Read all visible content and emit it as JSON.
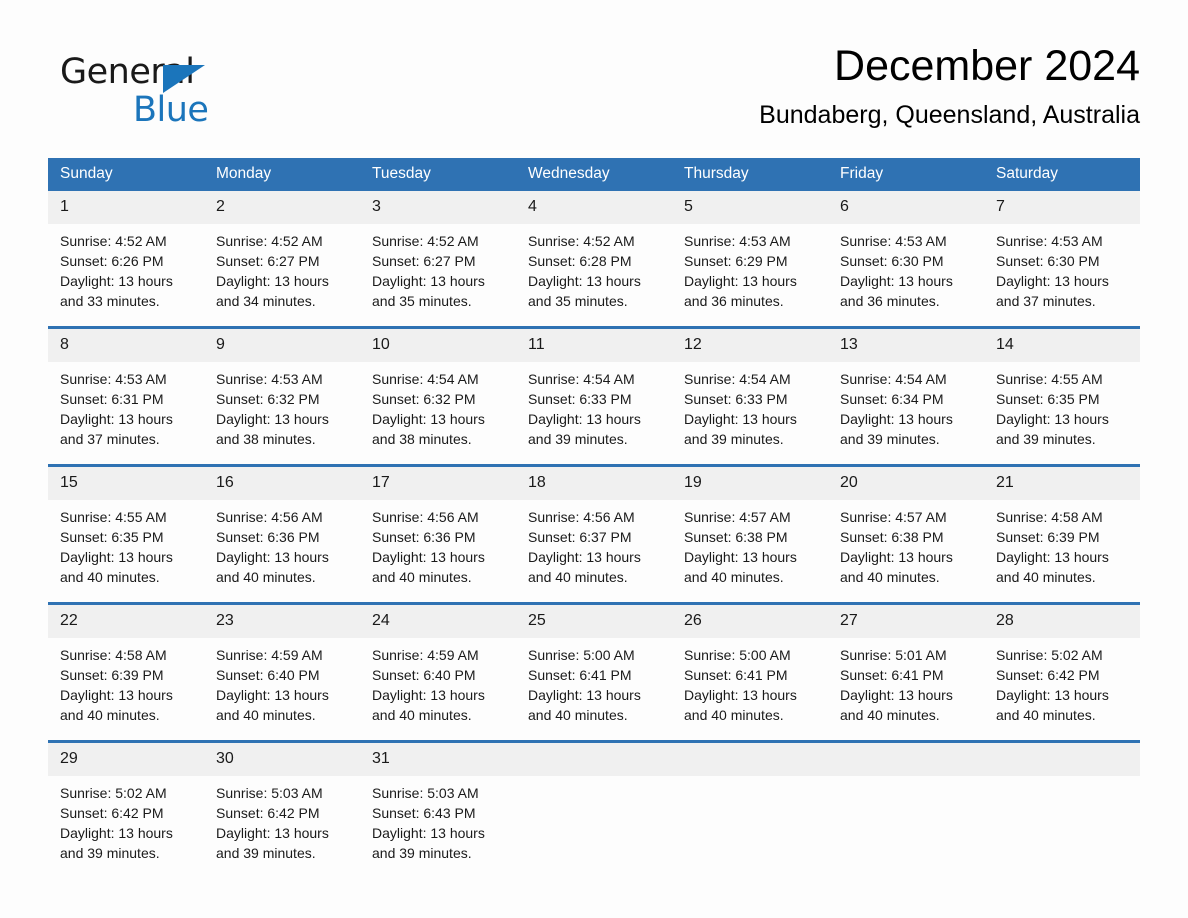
{
  "logo": {
    "word_dark": "General",
    "word_blue": "Blue",
    "triangle_color": "#1b75bb"
  },
  "header": {
    "title": "December 2024",
    "subtitle": "Bundaberg, Queensland, Australia"
  },
  "colors": {
    "header_blue": "#2f72b3",
    "daynum_band": "#f0f0f0",
    "page_background": "#fdfdfd",
    "text": "#1a1a1a"
  },
  "weekday_headers": [
    "Sunday",
    "Monday",
    "Tuesday",
    "Wednesday",
    "Thursday",
    "Friday",
    "Saturday"
  ],
  "weeks": [
    [
      {
        "day": "1",
        "sunrise": "Sunrise: 4:52 AM",
        "sunset": "Sunset: 6:26 PM",
        "daylight_line1": "Daylight: 13 hours",
        "daylight_line2": "and 33 minutes."
      },
      {
        "day": "2",
        "sunrise": "Sunrise: 4:52 AM",
        "sunset": "Sunset: 6:27 PM",
        "daylight_line1": "Daylight: 13 hours",
        "daylight_line2": "and 34 minutes."
      },
      {
        "day": "3",
        "sunrise": "Sunrise: 4:52 AM",
        "sunset": "Sunset: 6:27 PM",
        "daylight_line1": "Daylight: 13 hours",
        "daylight_line2": "and 35 minutes."
      },
      {
        "day": "4",
        "sunrise": "Sunrise: 4:52 AM",
        "sunset": "Sunset: 6:28 PM",
        "daylight_line1": "Daylight: 13 hours",
        "daylight_line2": "and 35 minutes."
      },
      {
        "day": "5",
        "sunrise": "Sunrise: 4:53 AM",
        "sunset": "Sunset: 6:29 PM",
        "daylight_line1": "Daylight: 13 hours",
        "daylight_line2": "and 36 minutes."
      },
      {
        "day": "6",
        "sunrise": "Sunrise: 4:53 AM",
        "sunset": "Sunset: 6:30 PM",
        "daylight_line1": "Daylight: 13 hours",
        "daylight_line2": "and 36 minutes."
      },
      {
        "day": "7",
        "sunrise": "Sunrise: 4:53 AM",
        "sunset": "Sunset: 6:30 PM",
        "daylight_line1": "Daylight: 13 hours",
        "daylight_line2": "and 37 minutes."
      }
    ],
    [
      {
        "day": "8",
        "sunrise": "Sunrise: 4:53 AM",
        "sunset": "Sunset: 6:31 PM",
        "daylight_line1": "Daylight: 13 hours",
        "daylight_line2": "and 37 minutes."
      },
      {
        "day": "9",
        "sunrise": "Sunrise: 4:53 AM",
        "sunset": "Sunset: 6:32 PM",
        "daylight_line1": "Daylight: 13 hours",
        "daylight_line2": "and 38 minutes."
      },
      {
        "day": "10",
        "sunrise": "Sunrise: 4:54 AM",
        "sunset": "Sunset: 6:32 PM",
        "daylight_line1": "Daylight: 13 hours",
        "daylight_line2": "and 38 minutes."
      },
      {
        "day": "11",
        "sunrise": "Sunrise: 4:54 AM",
        "sunset": "Sunset: 6:33 PM",
        "daylight_line1": "Daylight: 13 hours",
        "daylight_line2": "and 39 minutes."
      },
      {
        "day": "12",
        "sunrise": "Sunrise: 4:54 AM",
        "sunset": "Sunset: 6:33 PM",
        "daylight_line1": "Daylight: 13 hours",
        "daylight_line2": "and 39 minutes."
      },
      {
        "day": "13",
        "sunrise": "Sunrise: 4:54 AM",
        "sunset": "Sunset: 6:34 PM",
        "daylight_line1": "Daylight: 13 hours",
        "daylight_line2": "and 39 minutes."
      },
      {
        "day": "14",
        "sunrise": "Sunrise: 4:55 AM",
        "sunset": "Sunset: 6:35 PM",
        "daylight_line1": "Daylight: 13 hours",
        "daylight_line2": "and 39 minutes."
      }
    ],
    [
      {
        "day": "15",
        "sunrise": "Sunrise: 4:55 AM",
        "sunset": "Sunset: 6:35 PM",
        "daylight_line1": "Daylight: 13 hours",
        "daylight_line2": "and 40 minutes."
      },
      {
        "day": "16",
        "sunrise": "Sunrise: 4:56 AM",
        "sunset": "Sunset: 6:36 PM",
        "daylight_line1": "Daylight: 13 hours",
        "daylight_line2": "and 40 minutes."
      },
      {
        "day": "17",
        "sunrise": "Sunrise: 4:56 AM",
        "sunset": "Sunset: 6:36 PM",
        "daylight_line1": "Daylight: 13 hours",
        "daylight_line2": "and 40 minutes."
      },
      {
        "day": "18",
        "sunrise": "Sunrise: 4:56 AM",
        "sunset": "Sunset: 6:37 PM",
        "daylight_line1": "Daylight: 13 hours",
        "daylight_line2": "and 40 minutes."
      },
      {
        "day": "19",
        "sunrise": "Sunrise: 4:57 AM",
        "sunset": "Sunset: 6:38 PM",
        "daylight_line1": "Daylight: 13 hours",
        "daylight_line2": "and 40 minutes."
      },
      {
        "day": "20",
        "sunrise": "Sunrise: 4:57 AM",
        "sunset": "Sunset: 6:38 PM",
        "daylight_line1": "Daylight: 13 hours",
        "daylight_line2": "and 40 minutes."
      },
      {
        "day": "21",
        "sunrise": "Sunrise: 4:58 AM",
        "sunset": "Sunset: 6:39 PM",
        "daylight_line1": "Daylight: 13 hours",
        "daylight_line2": "and 40 minutes."
      }
    ],
    [
      {
        "day": "22",
        "sunrise": "Sunrise: 4:58 AM",
        "sunset": "Sunset: 6:39 PM",
        "daylight_line1": "Daylight: 13 hours",
        "daylight_line2": "and 40 minutes."
      },
      {
        "day": "23",
        "sunrise": "Sunrise: 4:59 AM",
        "sunset": "Sunset: 6:40 PM",
        "daylight_line1": "Daylight: 13 hours",
        "daylight_line2": "and 40 minutes."
      },
      {
        "day": "24",
        "sunrise": "Sunrise: 4:59 AM",
        "sunset": "Sunset: 6:40 PM",
        "daylight_line1": "Daylight: 13 hours",
        "daylight_line2": "and 40 minutes."
      },
      {
        "day": "25",
        "sunrise": "Sunrise: 5:00 AM",
        "sunset": "Sunset: 6:41 PM",
        "daylight_line1": "Daylight: 13 hours",
        "daylight_line2": "and 40 minutes."
      },
      {
        "day": "26",
        "sunrise": "Sunrise: 5:00 AM",
        "sunset": "Sunset: 6:41 PM",
        "daylight_line1": "Daylight: 13 hours",
        "daylight_line2": "and 40 minutes."
      },
      {
        "day": "27",
        "sunrise": "Sunrise: 5:01 AM",
        "sunset": "Sunset: 6:41 PM",
        "daylight_line1": "Daylight: 13 hours",
        "daylight_line2": "and 40 minutes."
      },
      {
        "day": "28",
        "sunrise": "Sunrise: 5:02 AM",
        "sunset": "Sunset: 6:42 PM",
        "daylight_line1": "Daylight: 13 hours",
        "daylight_line2": "and 40 minutes."
      }
    ],
    [
      {
        "day": "29",
        "sunrise": "Sunrise: 5:02 AM",
        "sunset": "Sunset: 6:42 PM",
        "daylight_line1": "Daylight: 13 hours",
        "daylight_line2": "and 39 minutes."
      },
      {
        "day": "30",
        "sunrise": "Sunrise: 5:03 AM",
        "sunset": "Sunset: 6:42 PM",
        "daylight_line1": "Daylight: 13 hours",
        "daylight_line2": "and 39 minutes."
      },
      {
        "day": "31",
        "sunrise": "Sunrise: 5:03 AM",
        "sunset": "Sunset: 6:43 PM",
        "daylight_line1": "Daylight: 13 hours",
        "daylight_line2": "and 39 minutes."
      },
      {
        "day": "",
        "sunrise": "",
        "sunset": "",
        "daylight_line1": "",
        "daylight_line2": ""
      },
      {
        "day": "",
        "sunrise": "",
        "sunset": "",
        "daylight_line1": "",
        "daylight_line2": ""
      },
      {
        "day": "",
        "sunrise": "",
        "sunset": "",
        "daylight_line1": "",
        "daylight_line2": ""
      },
      {
        "day": "",
        "sunrise": "",
        "sunset": "",
        "daylight_line1": "",
        "daylight_line2": ""
      }
    ]
  ]
}
